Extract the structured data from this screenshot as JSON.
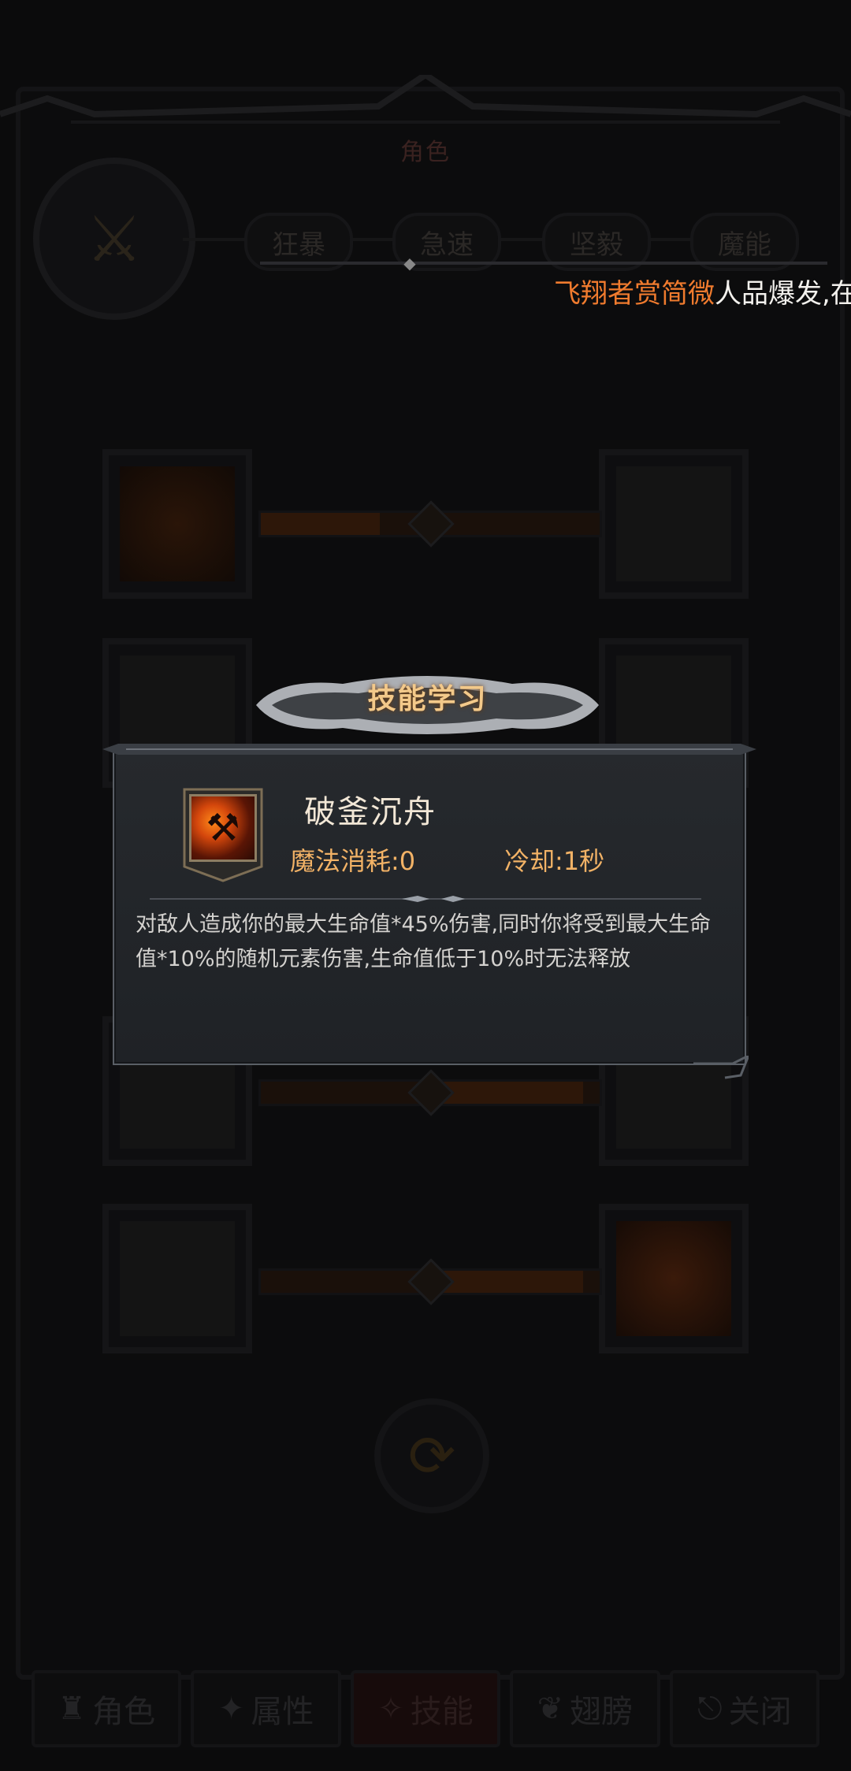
{
  "header": {
    "title": "角色"
  },
  "branches": [
    "狂暴",
    "急速",
    "坚毅",
    "魔能"
  ],
  "marquee": {
    "name": "飞翔者赏简微",
    "message": "人品爆发,在"
  },
  "dialog": {
    "banner_title": "技能学习",
    "skill_name": "破釜沉舟",
    "mana_cost": "魔法消耗:0",
    "cooldown": "冷却:1秒",
    "description": "对敌人造成你的最大生命值*45%伤害,同时你将受到最大生命值*10%的随机元素伤害,生命值低于10%时无法释放"
  },
  "bottom_tabs": [
    {
      "label": "角色",
      "icon": "helmet-icon"
    },
    {
      "label": "属性",
      "icon": "attribute-icon"
    },
    {
      "label": "技能",
      "icon": "skill-icon",
      "active": true
    },
    {
      "label": "翅膀",
      "icon": "wing-icon"
    },
    {
      "label": "关闭",
      "icon": "exit-icon"
    }
  ],
  "colors": {
    "accent_orange": "#f07b2e",
    "title_gold": "#f3c98a",
    "stat_orange": "#f2b266"
  }
}
